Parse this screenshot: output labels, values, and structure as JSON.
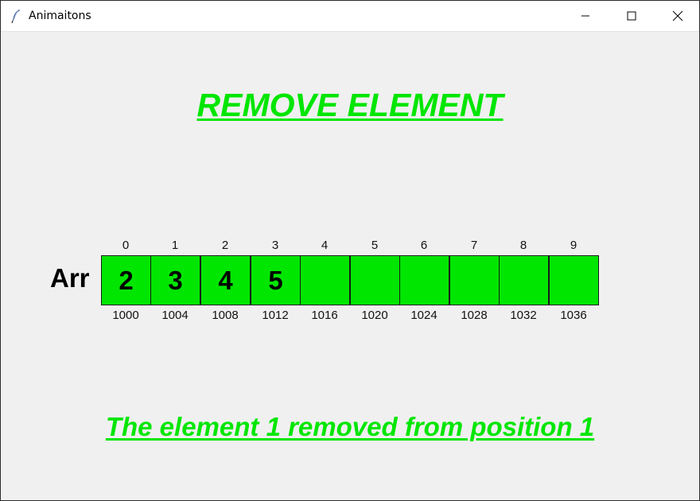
{
  "window": {
    "title": "Animaitons",
    "icons": {
      "app": "feather-icon",
      "minimize": "minimize-icon",
      "maximize": "maximize-icon",
      "close": "close-icon"
    }
  },
  "main": {
    "heading": "REMOVE ELEMENT",
    "array_label": "Arr",
    "indices": [
      "0",
      "1",
      "2",
      "3",
      "4",
      "5",
      "6",
      "7",
      "8",
      "9"
    ],
    "cells": [
      "2",
      "3",
      "4",
      "5",
      "",
      "",
      "",
      "",
      "",
      ""
    ],
    "addresses": [
      "1000",
      "1004",
      "1008",
      "1012",
      "1016",
      "1020",
      "1024",
      "1028",
      "1032",
      "1036"
    ],
    "status_message": "The element 1 removed from position 1"
  },
  "colors": {
    "accent_green": "#00e600",
    "background": "#f0f0f0",
    "titlebar": "#ffffff"
  }
}
